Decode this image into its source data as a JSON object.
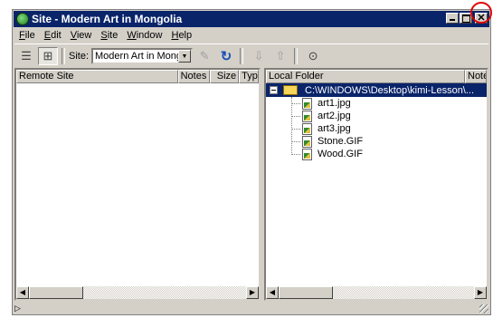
{
  "window": {
    "title": "Site - Modern Art in Mongolia",
    "buttons": {
      "minimize": "_",
      "maximize": "□",
      "close": "✕"
    }
  },
  "menu": [
    {
      "label": "File",
      "mnemonic": "F"
    },
    {
      "label": "Edit",
      "mnemonic": "E"
    },
    {
      "label": "View",
      "mnemonic": "V"
    },
    {
      "label": "Site",
      "mnemonic": "S"
    },
    {
      "label": "Window",
      "mnemonic": "W"
    },
    {
      "label": "Help",
      "mnemonic": "H"
    }
  ],
  "toolbar": {
    "site_label": "Site:",
    "site_value": "Modern Art in Mongolia",
    "icons": [
      "site-files-icon",
      "site-map-icon",
      "connect-icon",
      "refresh-icon",
      "get-icon",
      "put-icon",
      "help-icon"
    ]
  },
  "remote_pane": {
    "columns": [
      "Remote Site",
      "Notes",
      "Size",
      "Type"
    ]
  },
  "local_pane": {
    "columns": [
      "Local Folder",
      "Notes"
    ],
    "root": "C:\\WINDOWS\\Desktop\\kimi-Lesson\\...",
    "files": [
      "art1.jpg",
      "art2.jpg",
      "art3.jpg",
      "Stone.GIF",
      "Wood.GIF"
    ]
  },
  "colors": {
    "titlebar": "#0a246a",
    "face": "#d4d0c8",
    "annotation": "#e00000"
  }
}
